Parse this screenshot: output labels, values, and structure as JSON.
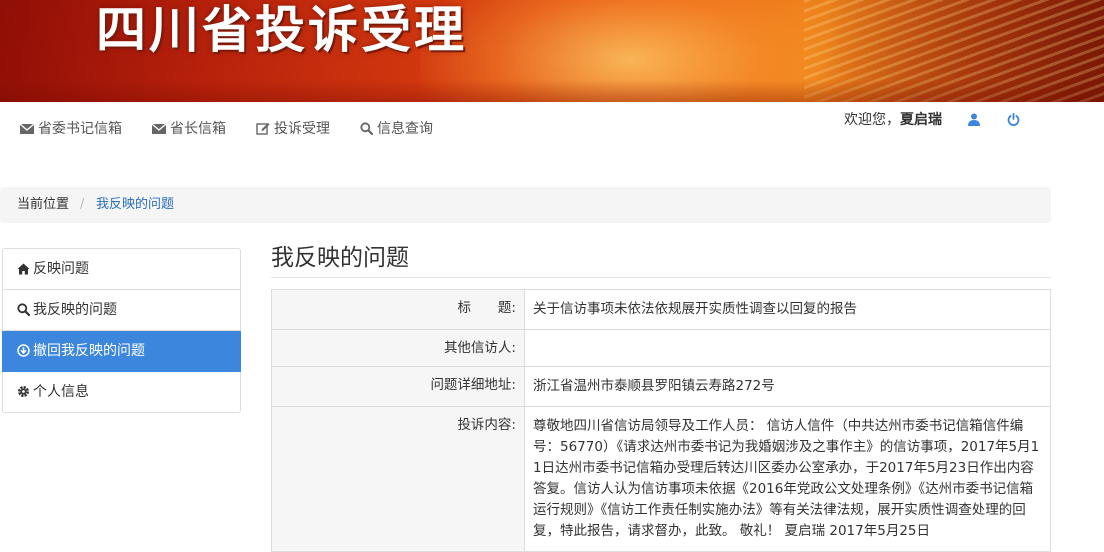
{
  "banner": {
    "title": "四川省投诉受理"
  },
  "topnav": {
    "items": [
      {
        "label": "省委书记信箱",
        "icon": "envelope-icon"
      },
      {
        "label": "省长信箱",
        "icon": "envelope-icon"
      },
      {
        "label": "投诉受理",
        "icon": "edit-icon"
      },
      {
        "label": "信息查询",
        "icon": "search-icon"
      }
    ]
  },
  "userbar": {
    "welcome": "欢迎您，",
    "username": "夏启瑞",
    "icons": [
      "user-icon",
      "power-icon"
    ]
  },
  "breadcrumb": {
    "current_label": "当前位置",
    "separator": "/",
    "page": "我反映的问题"
  },
  "sidebar": {
    "items": [
      {
        "label": "反映问题",
        "icon": "home-icon",
        "active": false
      },
      {
        "label": "我反映的问题",
        "icon": "search-icon",
        "active": false
      },
      {
        "label": "撤回我反映的问题",
        "icon": "download-circle-icon",
        "active": true
      },
      {
        "label": "个人信息",
        "icon": "gear-icon",
        "active": false
      }
    ]
  },
  "main": {
    "title": "我反映的问题",
    "rows": [
      {
        "label": "标　　题:",
        "value": "关于信访事项未依法依规展开实质性调查以回复的报告"
      },
      {
        "label": "其他信访人:",
        "value": ""
      },
      {
        "label": "问题详细地址:",
        "value": "浙江省温州市泰顺县罗阳镇云寿路272号"
      },
      {
        "label": "投诉内容:",
        "value": "尊敬地四川省信访局领导及工作人员： 信访人信件（中共达州市委书记信箱信件编号：56770）《请求达州市委书记为我婚姻涉及之事作主》的信访事项，2017年5月11日达州市委书记信箱办受理后转达川区委办公室承办，于2017年5月23日作出内容答复。信访人认为信访事项未依据《2016年党政公文处理条例》《达州市委书记信箱运行规则》《信访工作责任制实施办法》等有关法律法规，展开实质性调查处理的回复，特此报告，请求督办，此致。 敬礼！ 夏启瑞 2017年5月25日"
      }
    ]
  },
  "colors": {
    "accent": "#3c86de",
    "link": "#2a6fbe",
    "banner_red": "#c0280c"
  }
}
